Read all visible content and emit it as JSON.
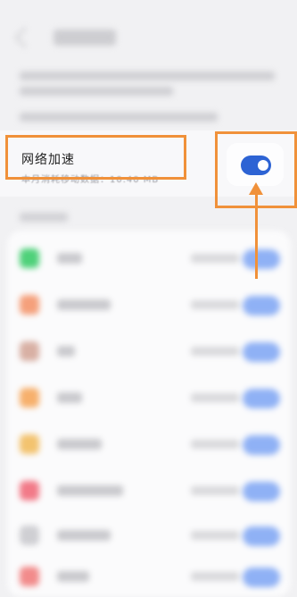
{
  "network_accel": {
    "title": "网络加速",
    "subtitle": "本月消耗移动数据：10.40 MB",
    "enabled": true
  },
  "colors": {
    "highlight": "#f0913a",
    "toggle_on": "#2d63d4",
    "background": "#f1f1f3"
  },
  "apps_icons": [
    "#4fd17a",
    "#f5a07b",
    "#d8b0a4",
    "#f7b06c",
    "#f3c36f",
    "#f27a88",
    "#cfcfd3",
    "#f28b8b"
  ]
}
